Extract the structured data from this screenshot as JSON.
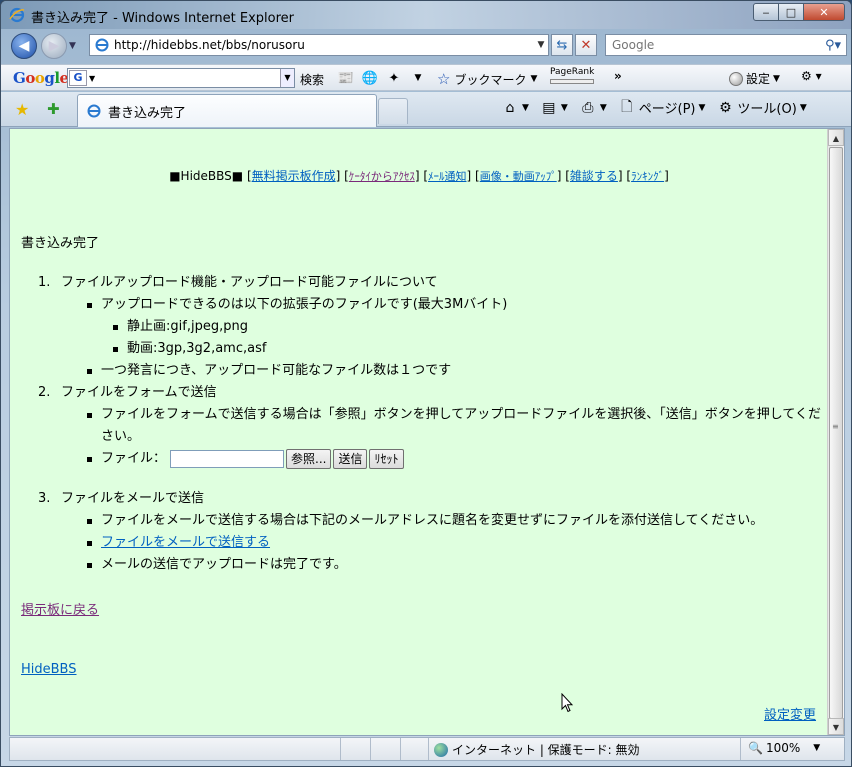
{
  "window": {
    "title": "書き込み完了 - Windows Internet Explorer",
    "minimize": "‒",
    "maximize": "□",
    "close": "✕"
  },
  "address": {
    "url": "http://hidebbs.net/bbs/norusoru",
    "search_placeholder": "Google"
  },
  "google_toolbar": {
    "logo": [
      "G",
      "o",
      "o",
      "g",
      "l",
      "e"
    ],
    "search_label": "検索",
    "bookmarks_label": "ブックマーク",
    "pagerank_label": "PageRank",
    "chevron": "»",
    "settings_label": "設定"
  },
  "tabs": [
    {
      "label": "書き込み完了"
    }
  ],
  "commandbar": {
    "page_label": "ページ(P)",
    "tools_label": "ツール(O)"
  },
  "content": {
    "topnav": {
      "prefix": "■HideBBS■",
      "links": [
        {
          "label": "無料掲示板作成",
          "small": false
        },
        {
          "label": "ｹｰﾀｲからｱｸｾｽ",
          "small": true
        },
        {
          "label": "ﾒｰﾙ通知",
          "small": true
        },
        {
          "label": "画像・動画ｱｯﾌﾟ",
          "small": true
        },
        {
          "label": "雑談する",
          "small": false
        },
        {
          "label": "ﾗﾝｷﾝｸﾞ",
          "small": true
        }
      ]
    },
    "heading": "書き込み完了",
    "sections": [
      {
        "num": "1.",
        "title": "ファイルアップロード機能・アップロード可能ファイルについて",
        "items": [
          "アップロードできるのは以下の拡張子のファイルです(最大3Mバイト)",
          "一つ発言につき、アップロード可能なファイル数は１つです"
        ],
        "subitems": [
          "静止画:gif,jpeg,png",
          "動画:3gp,3g2,amc,asf"
        ]
      },
      {
        "num": "2.",
        "title": "ファイルをフォームで送信",
        "items": [
          "ファイルをフォームで送信する場合は「参照」ボタンを押してアップロードファイルを選択後、「送信」ボタンを押してください。"
        ],
        "file_label": "ファイル：",
        "browse_button": "参照...",
        "submit_button": "送信",
        "reset_button": "ﾘｾｯﾄ"
      },
      {
        "num": "3.",
        "title": "ファイルをメールで送信",
        "items": [
          "ファイルをメールで送信する場合は下記のメールアドレスに題名を変更せずにファイルを添付送信してください。",
          "ファイルをメールで送信する",
          "メールの送信でアップロードは完了です。"
        ]
      }
    ],
    "back_link": "掲示板に戻る",
    "footer_link": "HideBBS",
    "settings_link": "設定変更"
  },
  "statusbar": {
    "zone": "インターネット | 保護モード: 無効",
    "zoom": "100%"
  },
  "colors": {
    "page_bg": "#dfffdf",
    "link": "#0060c0",
    "visited": "#7a2a7a"
  }
}
